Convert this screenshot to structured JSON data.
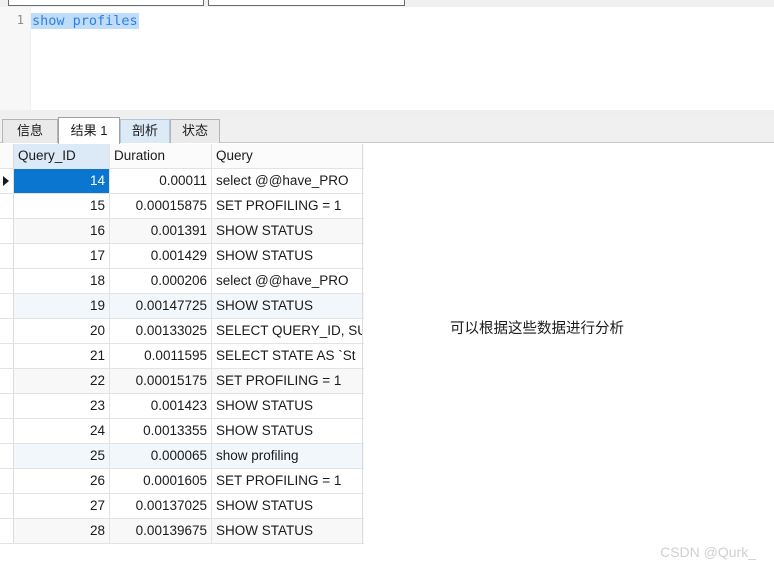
{
  "toolbar": {
    "input_left_value": "",
    "input_right_value": ""
  },
  "editor": {
    "line_number": "1",
    "code": "show profiles",
    "selection_color": "#bfdcfb",
    "text_color": "#2f7fe0"
  },
  "tabs": [
    {
      "label": "信息",
      "state": "normal"
    },
    {
      "label": "结果 1",
      "state": "active"
    },
    {
      "label": "剖析",
      "state": "tinted"
    },
    {
      "label": "状态",
      "state": "normal"
    }
  ],
  "grid": {
    "columns": [
      "Query_ID",
      "Duration",
      "Query"
    ],
    "active_column": "Query_ID",
    "selected_row_index": 0,
    "selection_color": "#0b76d0",
    "header_active_color": "#dce9f7",
    "rows": [
      {
        "query_id": "14",
        "duration": "0.00011",
        "query": "select @@have_PRO"
      },
      {
        "query_id": "15",
        "duration": "0.00015875",
        "query": "SET PROFILING = 1"
      },
      {
        "query_id": "16",
        "duration": "0.001391",
        "query": "SHOW STATUS"
      },
      {
        "query_id": "17",
        "duration": "0.001429",
        "query": "SHOW STATUS"
      },
      {
        "query_id": "18",
        "duration": "0.000206",
        "query": "select @@have_PRO"
      },
      {
        "query_id": "19",
        "duration": "0.00147725",
        "query": "SHOW STATUS"
      },
      {
        "query_id": "20",
        "duration": "0.00133025",
        "query": "SELECT QUERY_ID, SU"
      },
      {
        "query_id": "21",
        "duration": "0.0011595",
        "query": "SELECT STATE AS `St"
      },
      {
        "query_id": "22",
        "duration": "0.00015175",
        "query": "SET PROFILING = 1"
      },
      {
        "query_id": "23",
        "duration": "0.001423",
        "query": "SHOW STATUS"
      },
      {
        "query_id": "24",
        "duration": "0.0013355",
        "query": "SHOW STATUS"
      },
      {
        "query_id": "25",
        "duration": "0.000065",
        "query": "show profiling"
      },
      {
        "query_id": "26",
        "duration": "0.0001605",
        "query": "SET PROFILING = 1"
      },
      {
        "query_id": "27",
        "duration": "0.00137025",
        "query": "SHOW STATUS"
      },
      {
        "query_id": "28",
        "duration": "0.00139675",
        "query": "SHOW STATUS"
      }
    ]
  },
  "annotation": {
    "text": "可以根据这些数据进行分析"
  },
  "watermark": {
    "text": "CSDN @Qurk_"
  }
}
